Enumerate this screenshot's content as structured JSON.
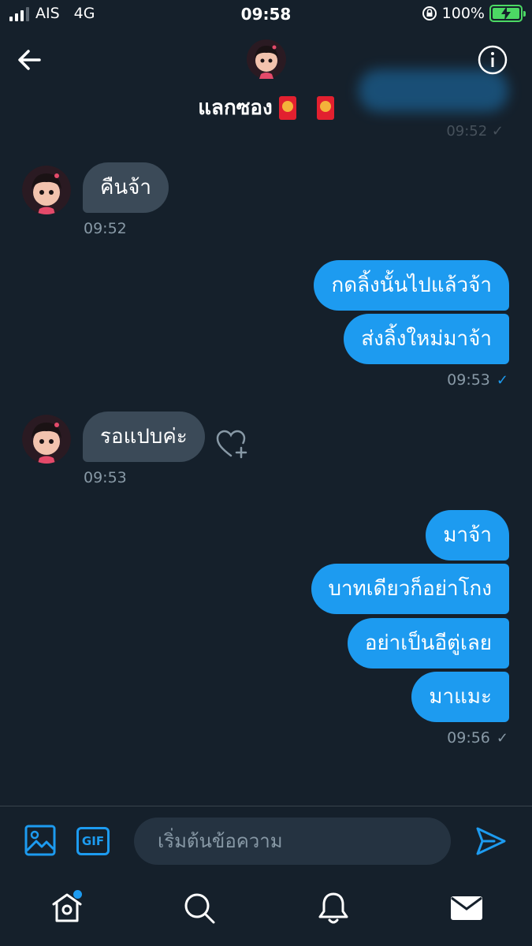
{
  "status_bar": {
    "carrier": "AIS",
    "network": "4G",
    "time": "09:58",
    "battery": "100%"
  },
  "header": {
    "title": "แลกซอง",
    "back_icon": "arrow-left-icon",
    "info_icon": "info-icon",
    "top_timestamp": "09:52"
  },
  "messages": [
    {
      "direction": "incoming",
      "text": "คืนจ้า",
      "time": "09:52"
    },
    {
      "direction": "outgoing",
      "text": "กดลิ้งนั้นไปแล้วจ้า"
    },
    {
      "direction": "outgoing",
      "text": "ส่งลิ้งใหม่มาจ้า",
      "time": "09:53",
      "status": "read"
    },
    {
      "direction": "incoming",
      "text": "รอแปบค่ะ",
      "time": "09:53"
    },
    {
      "direction": "outgoing",
      "text": "มาจ้า"
    },
    {
      "direction": "outgoing",
      "text": "บาทเดียวก็อย่าโกง"
    },
    {
      "direction": "outgoing",
      "text": "อย่าเป็นอีตู่เลย"
    },
    {
      "direction": "outgoing",
      "text": "มาแมะ",
      "time": "09:56",
      "status": "sent"
    }
  ],
  "composer": {
    "placeholder": "เริ่มต้นข้อความ",
    "gif_label": "GIF"
  },
  "nav": [
    "home-icon",
    "search-icon",
    "bell-icon",
    "mail-icon"
  ],
  "colors": {
    "background": "#15202b",
    "accent": "#1d9bf0",
    "incoming_bubble": "#3b4a58"
  }
}
